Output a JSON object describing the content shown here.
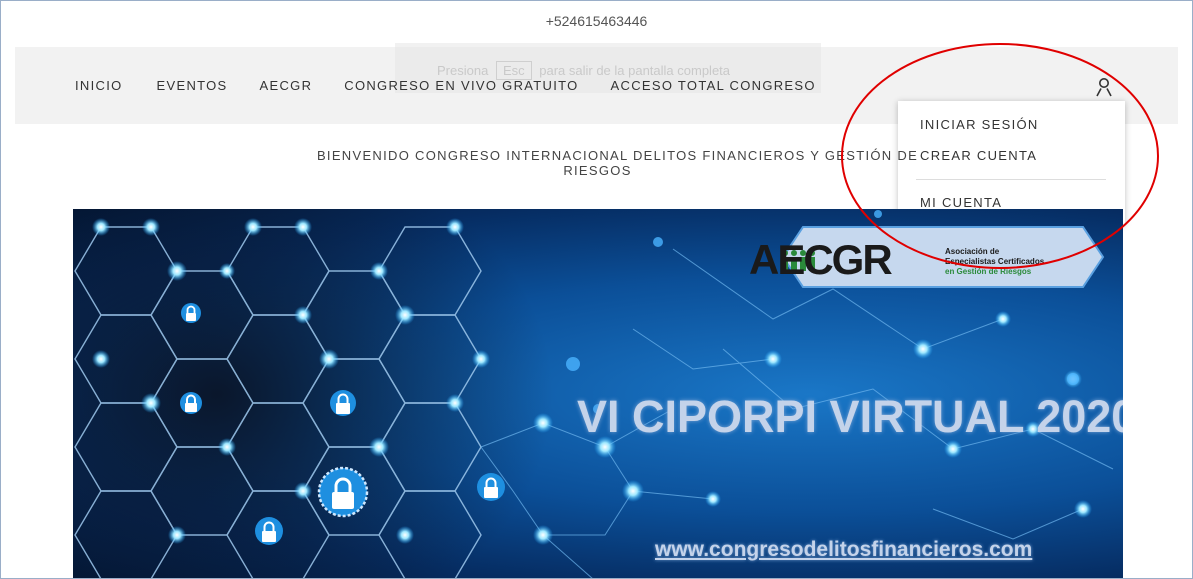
{
  "topbar": {
    "phone": "+524615463446"
  },
  "ghost_toast": {
    "pre": "Presiona",
    "key": "Esc",
    "post": "para salir de la pantalla completa"
  },
  "nav": {
    "items": [
      {
        "label": "INICIO"
      },
      {
        "label": "EVENTOS"
      },
      {
        "label": "AECGR"
      },
      {
        "label": "CONGRESO EN VIVO GRATUITO"
      },
      {
        "label": "ACCESO TOTAL CONGRESO"
      }
    ],
    "user_icon": "user-icon"
  },
  "account_menu": {
    "items": [
      {
        "label": "INICIAR SESIÓN"
      },
      {
        "label": "CREAR CUENTA"
      },
      {
        "label": "MI CUENTA"
      }
    ]
  },
  "welcome": {
    "line1": "BIENVENIDO CONGRESO INTERNACIONAL DELITOS FINANCIEROS Y GESTIÓN DE",
    "line2": "RIESGOS"
  },
  "banner": {
    "logo_text_main": "AECGR",
    "logo_subtitle": [
      "Asociación de",
      "Especialistas Certificados",
      "en Gestión de Riesgos"
    ],
    "title": "VI CIPORPI VIRTUAL 2020",
    "url": "www.congresodelitosfinancieros.com"
  },
  "colors": {
    "annotation_circle": "#e00000",
    "navbar_bg": "#f2f2f2",
    "banner_blue": "#0b4f98",
    "logo_green": "#2a8a3a"
  }
}
